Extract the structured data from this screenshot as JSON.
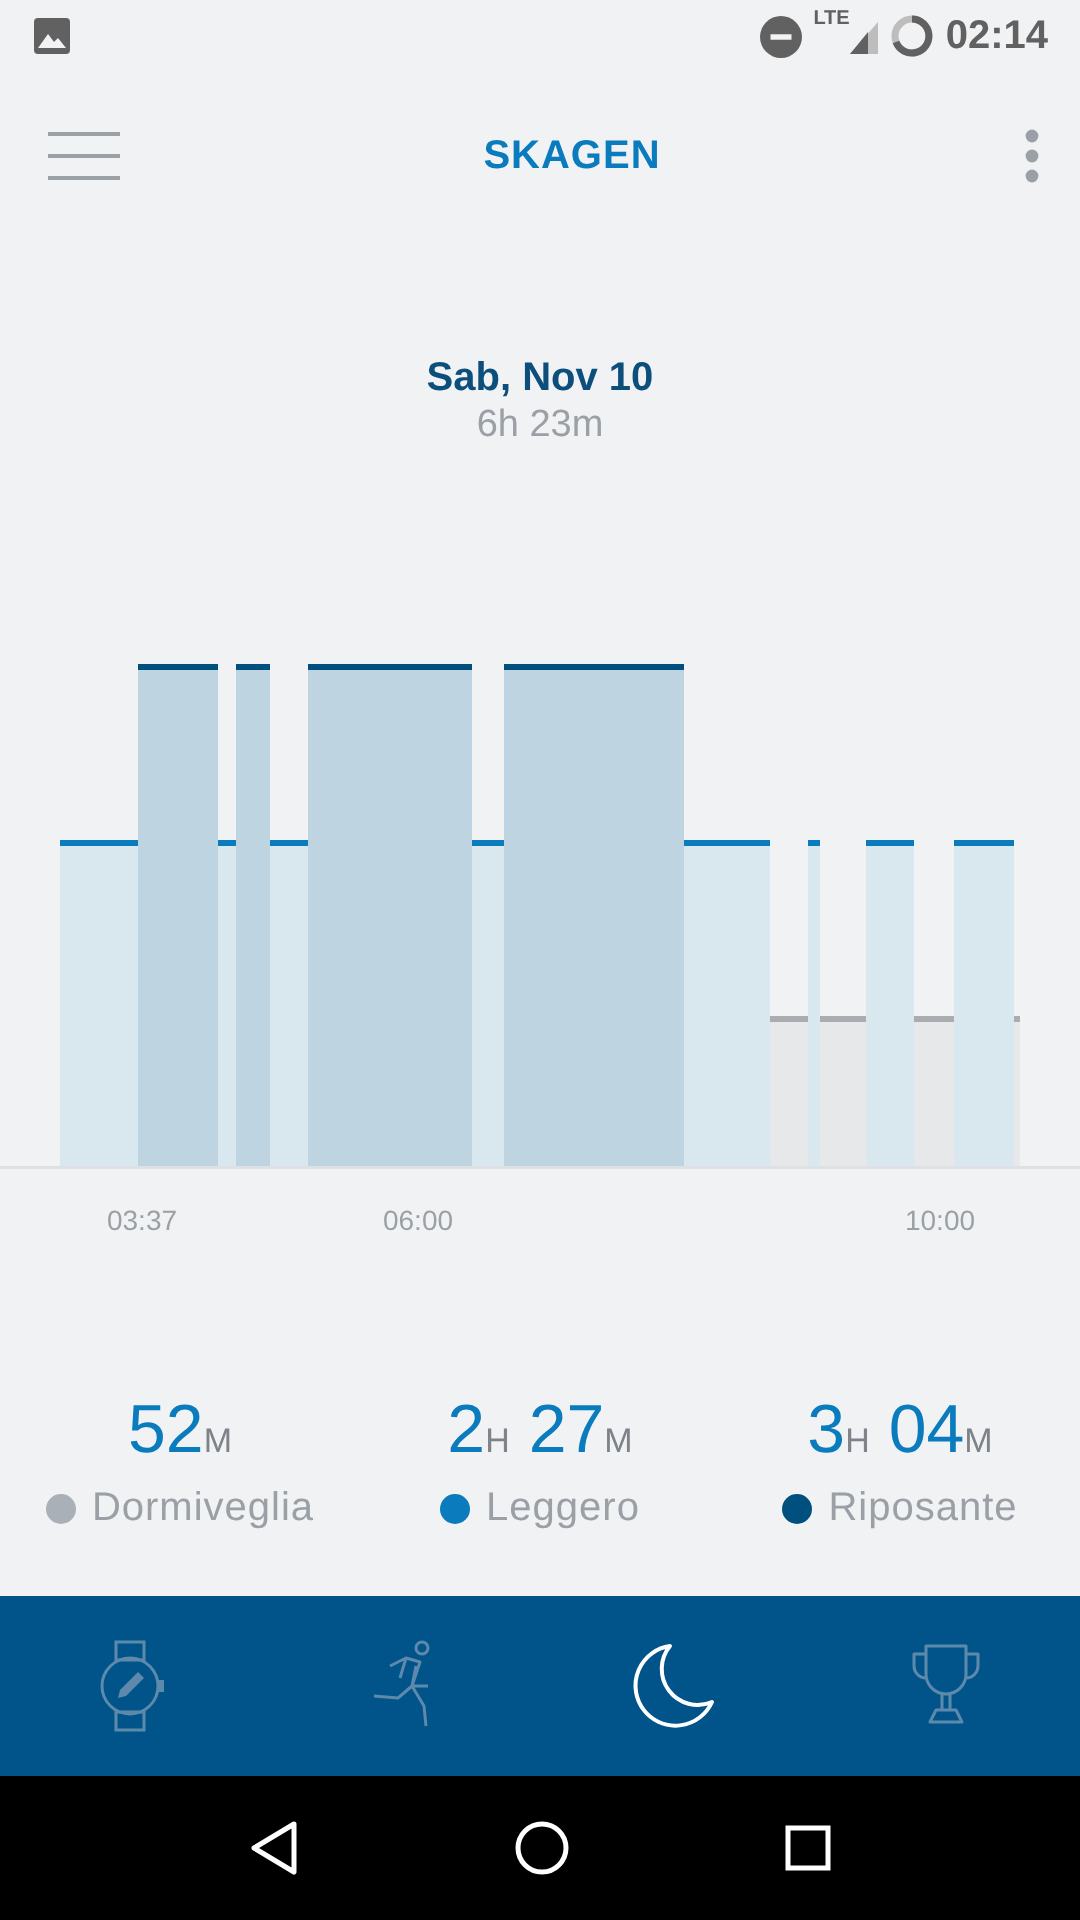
{
  "status_bar": {
    "network": "LTE",
    "time": "02:14"
  },
  "app_bar": {
    "title": "SKAGEN"
  },
  "summary": {
    "date": "Sab, Nov 10",
    "duration": "6h 23m"
  },
  "sleep_chart": {
    "time_labels": [
      "03:37",
      "06:00",
      "10:00"
    ]
  },
  "stats": [
    {
      "value": [
        {
          "text": "52",
          "kind": "number"
        },
        {
          "text": "M",
          "kind": "unit"
        }
      ],
      "label": "Dormiveglia",
      "color": "#aab0b7"
    },
    {
      "value": [
        {
          "text": "2",
          "kind": "number"
        },
        {
          "text": "H",
          "kind": "unit"
        },
        {
          "text": " 27",
          "kind": "number"
        },
        {
          "text": "M",
          "kind": "unit"
        }
      ],
      "label": "Leggero",
      "color": "#0a7bbd"
    },
    {
      "value": [
        {
          "text": "3",
          "kind": "number"
        },
        {
          "text": "H",
          "kind": "unit"
        },
        {
          "text": " 04",
          "kind": "number"
        },
        {
          "text": "M",
          "kind": "unit"
        }
      ],
      "label": "Riposante",
      "color": "#00507f"
    }
  ],
  "bottom_nav": [
    {
      "kind": "watch",
      "selected": false
    },
    {
      "kind": "runner",
      "selected": false
    },
    {
      "kind": "moon",
      "selected": true
    },
    {
      "kind": "trophy",
      "selected": false
    }
  ]
}
